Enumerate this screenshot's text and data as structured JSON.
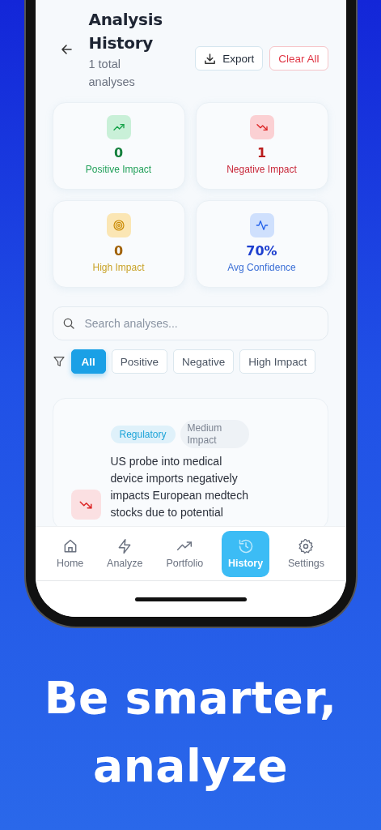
{
  "header": {
    "title": "Analysis History",
    "subtitle": "1 total analyses",
    "buttons": [
      {
        "label": "Export",
        "kind": "export"
      },
      {
        "label": "Clear All",
        "kind": "danger"
      }
    ]
  },
  "stats": [
    {
      "value": "0",
      "label": "Positive Impact",
      "kind": "positive"
    },
    {
      "value": "1",
      "label": "Negative Impact",
      "kind": "negative"
    },
    {
      "value": "0",
      "label": "High Impact",
      "kind": "high"
    },
    {
      "value": "70%",
      "label": "Avg Confidence",
      "kind": "confidence"
    }
  ],
  "search": {
    "placeholder": "Search analyses..."
  },
  "filters": [
    {
      "label": "All",
      "selected": true
    },
    {
      "label": "Positive",
      "selected": false
    },
    {
      "label": "Negative",
      "selected": false
    },
    {
      "label": "High Impact",
      "selected": false
    }
  ],
  "analyses": [
    {
      "kind": "negative",
      "tags": [
        {
          "label": "Regulatory",
          "kind": "category"
        },
        {
          "label": "Medium Impact",
          "kind": "impact"
        }
      ],
      "title": "US probe into medical device imports negatively impacts European medtech stocks due to potential"
    }
  ],
  "nav": [
    {
      "label": "Home",
      "kind": "home",
      "selected": false
    },
    {
      "label": "Analyze",
      "kind": "analyze",
      "selected": false
    },
    {
      "label": "Portfolio",
      "kind": "portfolio",
      "selected": false
    },
    {
      "label": "History",
      "kind": "history",
      "selected": true
    },
    {
      "label": "Settings",
      "kind": "settings",
      "selected": false
    }
  ],
  "headline": [
    "Be smarter,",
    "analyze"
  ]
}
